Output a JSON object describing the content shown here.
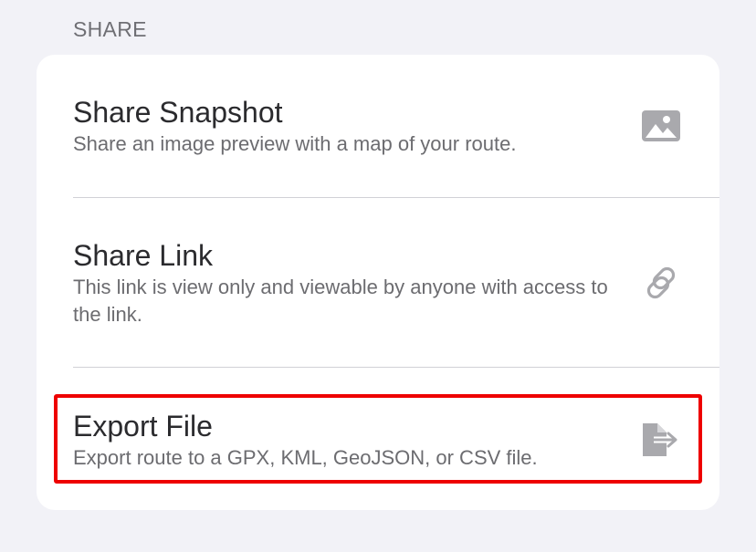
{
  "section": {
    "header": "SHARE"
  },
  "rows": [
    {
      "title": "Share Snapshot",
      "description": "Share an image preview with a map of your route.",
      "icon": "photo-icon"
    },
    {
      "title": "Share Link",
      "description": "This link is view only and viewable by anyone with access to the link.",
      "icon": "link-icon"
    },
    {
      "title": "Export File",
      "description": "Export route to a GPX, KML, GeoJSON, or CSV file.",
      "icon": "export-file-icon"
    }
  ],
  "colors": {
    "background": "#f2f2f7",
    "card": "#ffffff",
    "icon": "#a9a9ad",
    "highlight": "#ee0000"
  }
}
